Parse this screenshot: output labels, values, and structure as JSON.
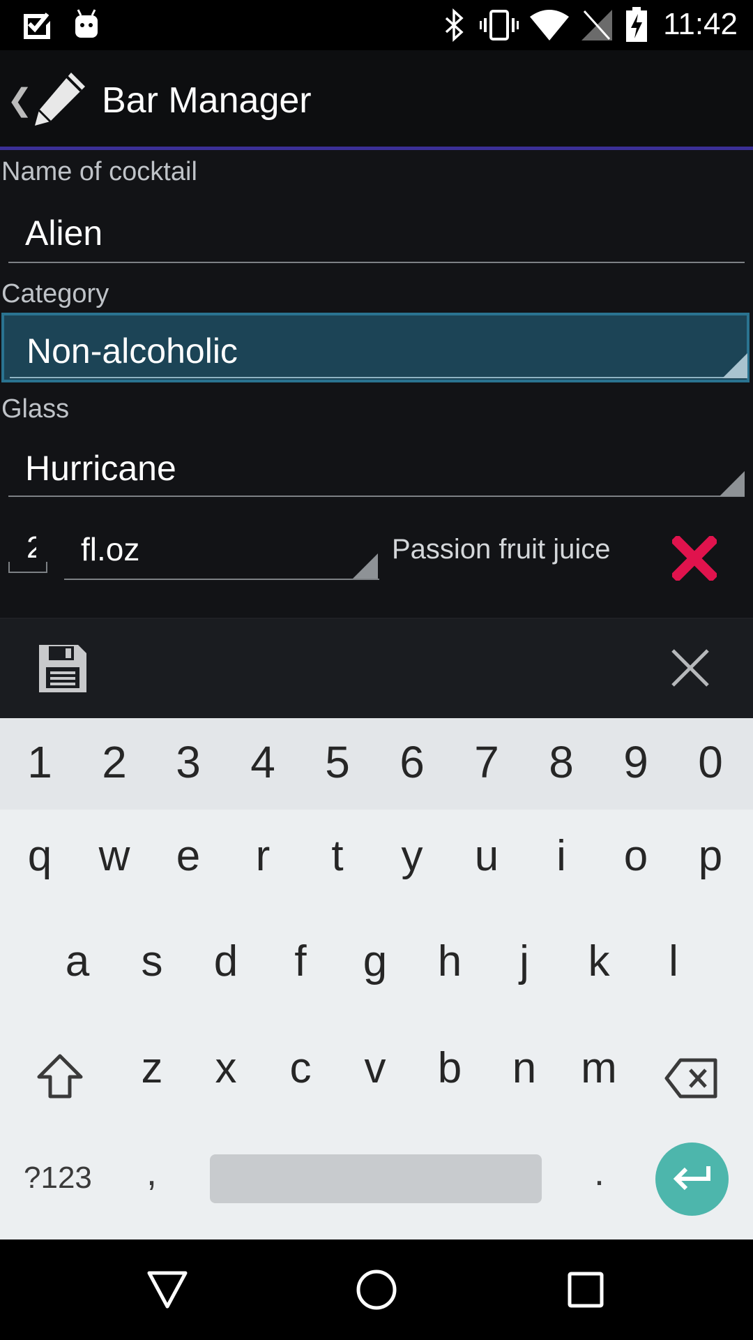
{
  "status_bar": {
    "time": "11:42",
    "left_icons": [
      "check-notification-icon",
      "android-debug-icon"
    ],
    "right_icons": [
      "bluetooth-icon",
      "vibrate-icon",
      "wifi-icon",
      "no-signal-icon",
      "battery-charging-icon"
    ]
  },
  "action_bar": {
    "title": "Bar Manager",
    "back_icon": "chevron-left-icon",
    "app_icon": "pencil-icon"
  },
  "form": {
    "name_label": "Name of cocktail",
    "name_value": "Alien",
    "category_label": "Category",
    "category_value": "Non-alcoholic",
    "glass_label": "Glass",
    "glass_value": "Hurricane",
    "ingredient": {
      "quantity": "2",
      "unit": "fl.oz",
      "name": "Passion fruit juice",
      "delete_icon": "red-x-delete-icon"
    }
  },
  "bottom_bar": {
    "save_icon": "floppy-disk-save-icon",
    "close_icon": "close-icon"
  },
  "keyboard": {
    "numbers": [
      "1",
      "2",
      "3",
      "4",
      "5",
      "6",
      "7",
      "8",
      "9",
      "0"
    ],
    "row1": [
      "q",
      "w",
      "e",
      "r",
      "t",
      "y",
      "u",
      "i",
      "o",
      "p"
    ],
    "row2": [
      "a",
      "s",
      "d",
      "f",
      "g",
      "h",
      "j",
      "k",
      "l"
    ],
    "row3": [
      "z",
      "x",
      "c",
      "v",
      "b",
      "n",
      "m"
    ],
    "symbols_key": "?123",
    "comma_key": ",",
    "period_key": ".",
    "accent_color": "#4db6ac"
  },
  "nav_bar": {
    "back_icon": "nav-back-triangle-icon",
    "home_icon": "nav-home-circle-icon",
    "recents_icon": "nav-recents-square-icon"
  },
  "colors": {
    "focus_field_bg": "#1c4456",
    "action_divider": "#3b2f96",
    "delete_red": "#e0134d"
  }
}
